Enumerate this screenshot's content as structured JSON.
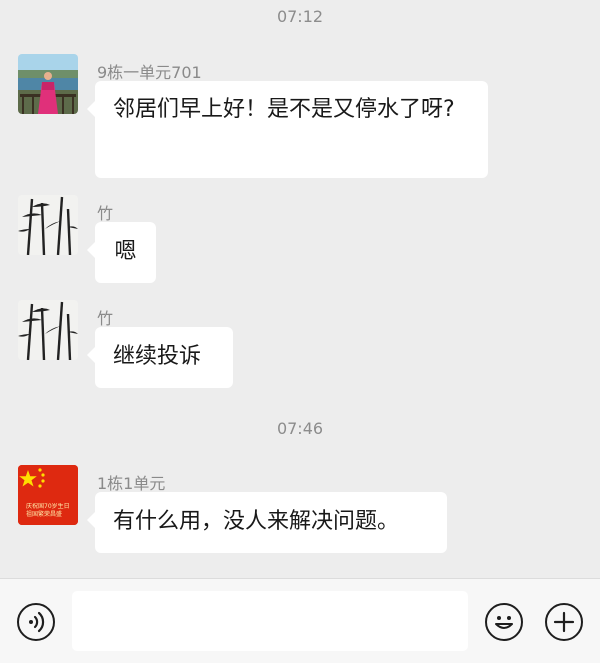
{
  "messages_area": {
    "time_1": "07:12",
    "time_2": "07:46",
    "messages": [
      {
        "sender": "9栋一单元701",
        "text": "邻居们早上好！是不是又停水了呀?"
      },
      {
        "sender": "竹",
        "text": "嗯"
      },
      {
        "sender": "竹",
        "text": "继续投诉"
      },
      {
        "sender": "1栋1单元",
        "text": "有什么用，没人来解决问题。"
      }
    ],
    "avatar_4_caption_line_1": "庆祝国70岁生日",
    "avatar_4_caption_line_2": "祖国繁荣昌盛"
  },
  "input_bar": {
    "voice_icon": "voice-icon",
    "emoji_icon": "emoji-icon",
    "plus_icon": "plus-icon",
    "message_input_value": ""
  },
  "colors": {
    "background": "#ededed",
    "bubble": "#ffffff",
    "time_text": "#8c8c8c",
    "flag_red": "#de2910",
    "flag_star": "#ffde00"
  }
}
